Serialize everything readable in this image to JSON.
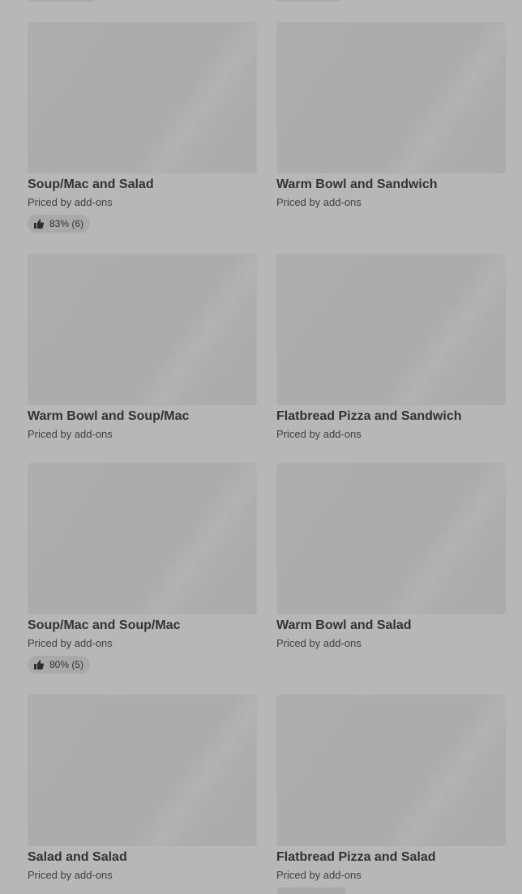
{
  "items": [
    {
      "title": "Soup/Mac and Salad",
      "subtitle": "Priced by add-ons",
      "rating": "83% (6)"
    },
    {
      "title": "Warm Bowl and Sandwich",
      "subtitle": "Priced by add-ons",
      "rating": null
    },
    {
      "title": "Warm Bowl and Soup/Mac",
      "subtitle": "Priced by add-ons",
      "rating": null
    },
    {
      "title": "Flatbread Pizza and Sandwich",
      "subtitle": "Priced by add-ons",
      "rating": null
    },
    {
      "title": "Soup/Mac and Soup/Mac",
      "subtitle": "Priced by add-ons",
      "rating": "80% (5)"
    },
    {
      "title": "Warm Bowl and Salad",
      "subtitle": "Priced by add-ons",
      "rating": null
    },
    {
      "title": "Salad and Salad",
      "subtitle": "Priced by add-ons",
      "rating": null
    },
    {
      "title": "Flatbread Pizza and Salad",
      "subtitle": "Priced by add-ons",
      "rating": null
    }
  ],
  "icons": {
    "rating": "thumbs-up-icon"
  },
  "colors": {
    "background": "#b7b7b7",
    "image_placeholder": "#adadad",
    "badge": "#a9a9a9",
    "text": "#333333"
  }
}
